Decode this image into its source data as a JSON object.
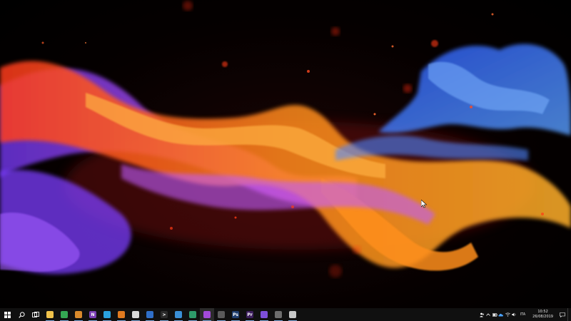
{
  "desktop": {
    "wallpaper": "fire-smoke-wallpaper",
    "colors": {
      "orange": "#ff7a1a",
      "purple": "#9b4dff",
      "blue": "#3f7dff",
      "red": "#ff2a10"
    }
  },
  "taskbar": {
    "start_icon": "windows-logo-icon",
    "search_icon": "search-icon",
    "taskview_icon": "task-view-icon",
    "apps": [
      {
        "name": "file-explorer-icon",
        "glyph": "",
        "color": "#f0c24b"
      },
      {
        "name": "chrome-icon",
        "glyph": "",
        "color": "#34a853"
      },
      {
        "name": "app-icon-1",
        "glyph": "",
        "color": "#d98a2b"
      },
      {
        "name": "onenote-icon",
        "glyph": "N",
        "color": "#7b3fb5"
      },
      {
        "name": "telegram-icon",
        "glyph": "",
        "color": "#2aa3e0"
      },
      {
        "name": "app-icon-2",
        "glyph": "",
        "color": "#e07a1f"
      },
      {
        "name": "app-icon-3",
        "glyph": "",
        "color": "#d9d9d9"
      },
      {
        "name": "bitwarden-icon",
        "glyph": "",
        "color": "#2f6fc9"
      },
      {
        "name": "terminal-icon",
        "glyph": ">",
        "color": "#2b2b2b"
      },
      {
        "name": "app-icon-4",
        "glyph": "",
        "color": "#3a8fd6"
      },
      {
        "name": "app-icon-5",
        "glyph": "",
        "color": "#2e9a6a"
      },
      {
        "name": "visual-studio-icon",
        "glyph": "",
        "color": "#a34ad9"
      },
      {
        "name": "app-icon-6",
        "glyph": "",
        "color": "#5a5a5a"
      },
      {
        "name": "photoshop-icon",
        "glyph": "Ps",
        "color": "#1f3d6e"
      },
      {
        "name": "premiere-icon",
        "glyph": "Pr",
        "color": "#3d1f5e"
      },
      {
        "name": "app-icon-7",
        "glyph": "",
        "color": "#7d4fd9"
      },
      {
        "name": "settings-icon",
        "glyph": "",
        "color": "#6d6d6d"
      },
      {
        "name": "app-icon-8",
        "glyph": "",
        "color": "#c8c8c8"
      }
    ],
    "tray": {
      "language": "ITA",
      "time": "10:52",
      "date": "26/08/2019"
    }
  }
}
